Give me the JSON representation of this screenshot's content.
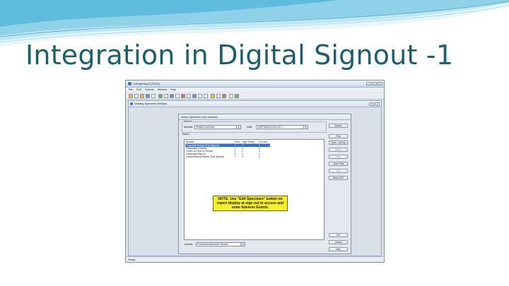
{
  "slide": {
    "title": "Integration in Digital Signout -1"
  },
  "app": {
    "title": "CoPathPlus® (TEST)",
    "menu": [
      "File",
      "Edit",
      "Options",
      "Window",
      "Help"
    ],
    "status": "Ready"
  },
  "child_window": {
    "title": "Grading Specimen Window"
  },
  "dialog": {
    "title": "Select Specimen from Worklist",
    "search_group": "Search",
    "worklist_label": "Worklist:",
    "worklist_value": "Worklist Summary",
    "staff_label": "Staff:",
    "staff_value": "HARTMAN,DOUGLAS J.",
    "select_group": "Select",
    "columns": [
      "Number",
      "Total",
      "High Priority",
      "On Hold"
    ],
    "rows": [
      {
        "number": "Procedure Review (Post Signout)",
        "total": "2",
        "high": "0",
        "hold": "0",
        "selected": true
      },
      {
        "number": "Pathologist Consults",
        "total": "0",
        "high": "0",
        "hold": "0",
        "selected": false
      },
      {
        "number": "Frozen vs Final Dx Review",
        "total": "1",
        "high": "0",
        "hold": "0",
        "selected": false
      },
      {
        "number": "Pathologist Signout",
        "total": "6",
        "high": "0",
        "hold": "0",
        "selected": false
      },
      {
        "number": "Consult/Intraop Review (Post Signout)",
        "total": "7",
        "high": "0",
        "hold": "0",
        "selected": false
      }
    ],
    "note": "NOTE: Use \"Edit Specimen\" button on report display at sign out to access and enter Adverse Events.",
    "activity_label": "Activity:",
    "activity_value": "Procedure/Addendum Review",
    "buttons": {
      "search": "Search",
      "find": "Find",
      "spec_lookup": "Spec. Lookup",
      "select": "Select",
      "filter": "Filter",
      "clear_filter": "Clear Filter",
      "sort": "Sort",
      "batch": "Batch S/O",
      "ok": "OK",
      "cancel": "Cancel",
      "help": "Help"
    }
  }
}
